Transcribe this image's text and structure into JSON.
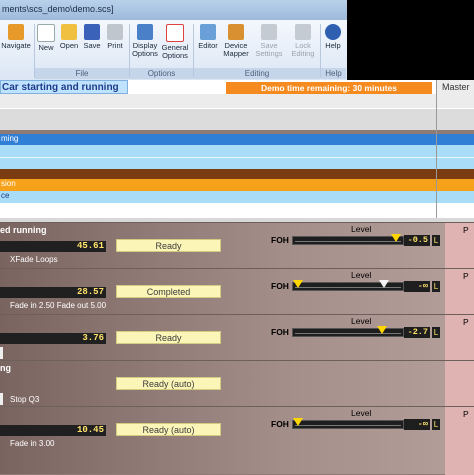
{
  "window": {
    "title": "ments\\scs_demo\\demo.scs]"
  },
  "ribbon": {
    "buttons": [
      {
        "label": "Navigate",
        "icon": "navigate-icon",
        "color": "#e79a2a"
      },
      {
        "label": "New",
        "icon": "new-icon",
        "color": "#ffffff"
      },
      {
        "label": "Open",
        "icon": "open-icon",
        "color": "#f0c040"
      },
      {
        "label": "Save",
        "icon": "save-icon",
        "color": "#3a62b8"
      },
      {
        "label": "Print",
        "icon": "print-icon",
        "color": "#c0c6ce"
      },
      {
        "label": "Display\nOptions",
        "icon": "display-options-icon",
        "color": "#4a80c8"
      },
      {
        "label": "General\nOptions",
        "icon": "general-options-icon",
        "color": "#e04040"
      },
      {
        "label": "Editor",
        "icon": "editor-icon",
        "color": "#6aa0d8"
      },
      {
        "label": "Device\nMapper",
        "icon": "device-mapper-icon",
        "color": "#d89030"
      },
      {
        "label": "Save\nSettings",
        "icon": "save-settings-icon",
        "color": "#b0b8c4"
      },
      {
        "label": "Lock\nEditing",
        "icon": "lock-editing-icon",
        "color": "#b0b8c4"
      },
      {
        "label": "Help",
        "icon": "help-icon",
        "color": "#2f5fb0"
      }
    ],
    "groups": [
      "File",
      "Options",
      "Editing",
      "Help"
    ]
  },
  "show": {
    "current_cue": "Car starting and running",
    "demo_banner": "Demo time remaining: 30 minutes",
    "master_label": "Master"
  },
  "cue_list": [
    {
      "text": "",
      "bg": "#ececec"
    },
    {
      "text": "",
      "bg": "#dcdcdc"
    },
    {
      "text": "ming",
      "bg": "#2f7fd6",
      "fg": "#ffffff"
    },
    {
      "text": "",
      "bg": "#a8dcf7"
    },
    {
      "text": "",
      "bg": "#a8dcf7"
    },
    {
      "text": "",
      "bg": "#7a3c10"
    },
    {
      "text": "sion",
      "bg": "#f5a21a",
      "fg": "#ffffff"
    },
    {
      "text": "ce",
      "bg": "#a8dcf7",
      "fg": "#1c3c80"
    },
    {
      "text": "",
      "bg": "#ffffff"
    }
  ],
  "level_panel": {
    "level_header": "Level",
    "pan_header": "P",
    "foh_label": "FOH",
    "l_label": "L",
    "cues": [
      {
        "name": "ed running",
        "time": "45.61",
        "status": "Ready",
        "sub": "XFade Loops",
        "db": "-0.5",
        "knob": "yellow",
        "knob_pos": 0.83
      },
      {
        "name": "",
        "time": "28.57",
        "status": "Completed",
        "sub": "Fade in 2.50   Fade out 5.00",
        "db": "-∞",
        "knob": "white",
        "knob_pos": 0.72
      },
      {
        "name": "",
        "time": "3.76",
        "status": "Ready",
        "sub": "",
        "db": "-2.7",
        "knob": "yellow",
        "knob_pos": 0.72
      },
      {
        "name": "ng",
        "time": "",
        "status": "Ready (auto)",
        "sub": "Stop Q3",
        "db": "",
        "knob": "",
        "knob_pos": 0
      },
      {
        "name": "",
        "time": "10.45",
        "status": "Ready (auto)",
        "sub": "Fade in 3.00",
        "db": "-∞",
        "knob": "yellow",
        "knob_pos": 0.0
      }
    ]
  }
}
